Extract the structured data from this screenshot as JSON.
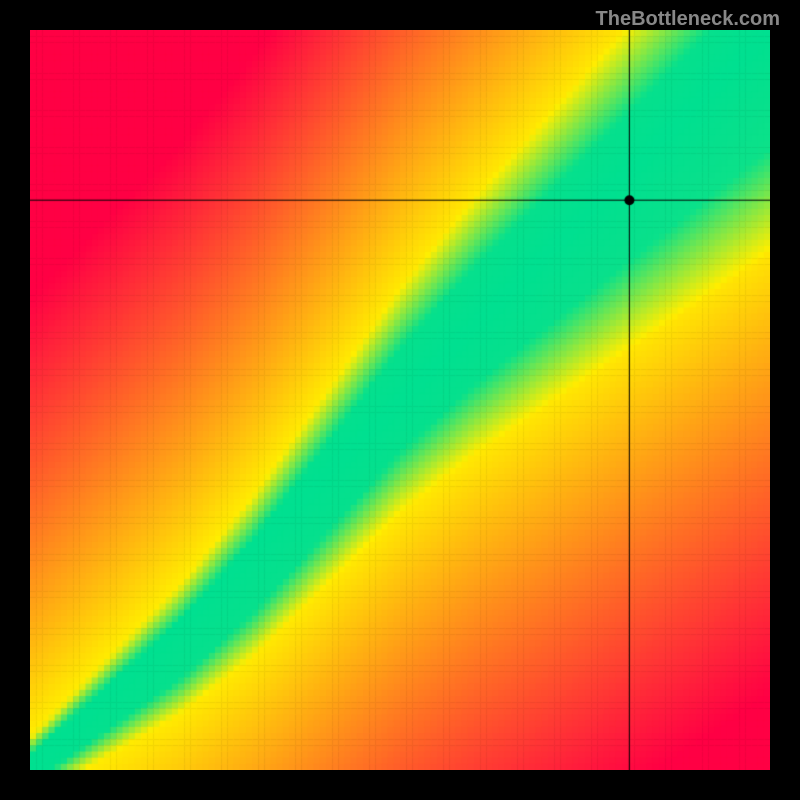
{
  "watermark": "TheBottleneck.com",
  "chart_data": {
    "type": "heatmap",
    "title": "",
    "xlabel": "",
    "ylabel": "",
    "xlim": [
      0,
      100
    ],
    "ylim": [
      0,
      100
    ],
    "crosshair": {
      "x": 81,
      "y": 77
    },
    "marker": {
      "x": 81,
      "y": 77
    },
    "color_scale": [
      {
        "value": 0,
        "color": "#ff0044"
      },
      {
        "value": 0.5,
        "color": "#ffee00"
      },
      {
        "value": 1,
        "color": "#00e090"
      }
    ],
    "optimal_curve_description": "Diagonal green band from bottom-left to top-right, with slight S-curve. Band narrows toward origin and widens toward upper-right. Red in far corners, yellow transition zones.",
    "optimal_anchors": [
      {
        "x": 0,
        "y": 0,
        "width": 2
      },
      {
        "x": 10,
        "y": 8,
        "width": 3
      },
      {
        "x": 20,
        "y": 16,
        "width": 4
      },
      {
        "x": 30,
        "y": 26,
        "width": 5
      },
      {
        "x": 40,
        "y": 38,
        "width": 6
      },
      {
        "x": 50,
        "y": 50,
        "width": 7
      },
      {
        "x": 60,
        "y": 60,
        "width": 8
      },
      {
        "x": 70,
        "y": 69,
        "width": 9
      },
      {
        "x": 80,
        "y": 78,
        "width": 10
      },
      {
        "x": 90,
        "y": 87,
        "width": 11
      },
      {
        "x": 100,
        "y": 96,
        "width": 12
      }
    ]
  }
}
